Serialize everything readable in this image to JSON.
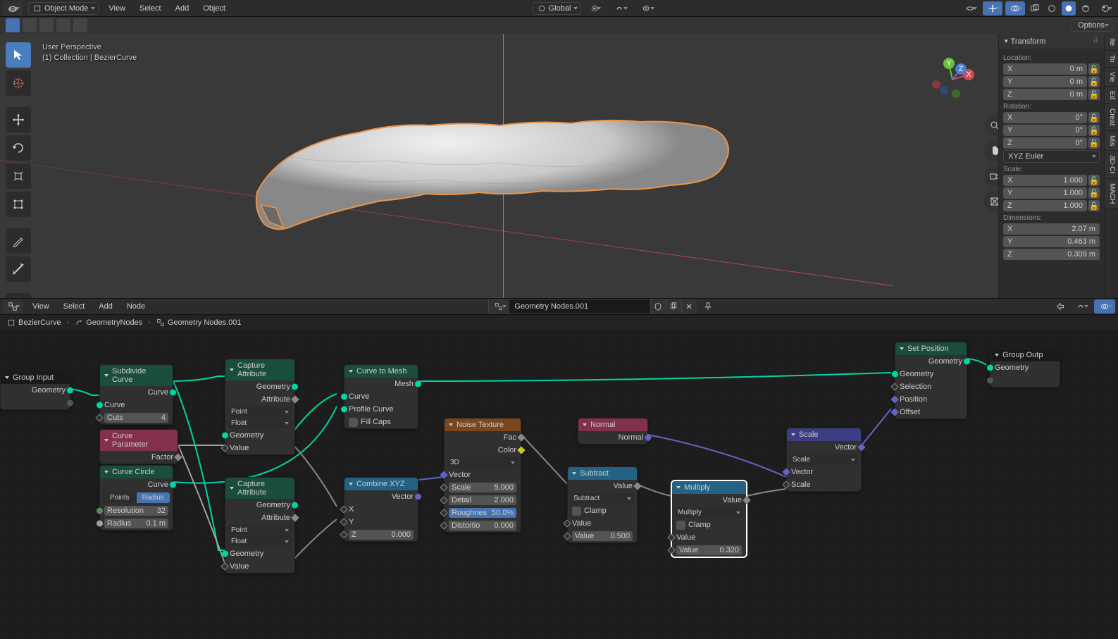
{
  "top": {
    "mode": "Object Mode",
    "menus": [
      "View",
      "Select",
      "Add",
      "Object"
    ],
    "orientation": "Global"
  },
  "shelf": {
    "options": "Options"
  },
  "viewport": {
    "perspective": "User Perspective",
    "breadcrumb": "(1) Collection | BezierCurve"
  },
  "npanel": {
    "header": "Transform",
    "loc_label": "Location:",
    "loc": [
      {
        "a": "X",
        "v": "0 m"
      },
      {
        "a": "Y",
        "v": "0 m"
      },
      {
        "a": "Z",
        "v": "0 m"
      }
    ],
    "rot_label": "Rotation:",
    "rot": [
      {
        "a": "X",
        "v": "0°"
      },
      {
        "a": "Y",
        "v": "0°"
      },
      {
        "a": "Z",
        "v": "0°"
      }
    ],
    "rot_mode": "XYZ Euler",
    "scale_label": "Scale:",
    "scale": [
      {
        "a": "X",
        "v": "1.000"
      },
      {
        "a": "Y",
        "v": "1.000"
      },
      {
        "a": "Z",
        "v": "1.000"
      }
    ],
    "dim_label": "Dimensions:",
    "dim": [
      {
        "a": "X",
        "v": "2.07 m"
      },
      {
        "a": "Y",
        "v": "0.463 m"
      },
      {
        "a": "Z",
        "v": "0.309 m"
      }
    ],
    "tabs": [
      "Ite",
      "To",
      "Vie",
      "Ed",
      "Creat",
      "Mis",
      "3D-Cr",
      "MACH"
    ]
  },
  "node_hdr": {
    "menus": [
      "View",
      "Select",
      "Add",
      "Node"
    ],
    "ng_name": "Geometry Nodes.001"
  },
  "breadcrumb": {
    "items": [
      "BezierCurve",
      "GeometryNodes",
      "Geometry Nodes.001"
    ]
  },
  "nodes": {
    "group_input": {
      "title": "Group Input",
      "out": "Geometry"
    },
    "subdivide": {
      "title": "Subdivide Curve",
      "out": "Curve",
      "in_curve": "Curve",
      "cuts_l": "Cuts",
      "cuts_v": "4"
    },
    "param": {
      "title": "Curve Parameter",
      "out": "Factor"
    },
    "circle": {
      "title": "Curve Circle",
      "out": "Curve",
      "radio": [
        "Points",
        "Radius"
      ],
      "res_l": "Resolution",
      "res_v": "32",
      "rad_l": "Radius",
      "rad_v": "0.1 m"
    },
    "cap1": {
      "title": "Capture Attribute",
      "o_g": "Geometry",
      "o_a": "Attribute",
      "d1": "Point",
      "d2": "Float",
      "i_g": "Geometry",
      "i_v": "Value"
    },
    "cap2": {
      "title": "Capture Attribute",
      "o_g": "Geometry",
      "o_a": "Attribute",
      "d1": "Point",
      "d2": "Float",
      "i_g": "Geometry",
      "i_v": "Value"
    },
    "c2m": {
      "title": "Curve to Mesh",
      "out": "Mesh",
      "i_c": "Curve",
      "i_p": "Profile Curve",
      "fill": "Fill Caps"
    },
    "cxyz": {
      "title": "Combine XYZ",
      "out": "Vector",
      "x": "X",
      "y": "Y",
      "z_l": "Z",
      "z_v": "0.000"
    },
    "noise": {
      "title": "Noise Texture",
      "o_f": "Fac",
      "o_c": "Color",
      "dim": "3D",
      "i_v": "Vector",
      "s_l": "Scale",
      "s_v": "5.000",
      "d_l": "Detail",
      "d_v": "2.000",
      "r_l": "Roughnes",
      "r_v": "50.0%",
      "di_l": "Distortio",
      "di_v": "0.000"
    },
    "sub": {
      "title": "Subtract",
      "out": "Value",
      "op": "Subtract",
      "clamp": "Clamp",
      "i_v": "Value",
      "v_l": "Value",
      "v_v": "0.500"
    },
    "normal": {
      "title": "Normal",
      "out": "Normal"
    },
    "mult": {
      "title": "Multiply",
      "out": "Value",
      "op": "Multiply",
      "clamp": "Clamp",
      "i_v": "Value",
      "v_l": "Value",
      "v_v": "0.320"
    },
    "vscale": {
      "title": "Scale",
      "out": "Vector",
      "op": "Scale",
      "i_v": "Vector",
      "i_s": "Scale"
    },
    "setpos": {
      "title": "Set Position",
      "o_g": "Geometry",
      "i_g": "Geometry",
      "i_sel": "Selection",
      "i_pos": "Position",
      "i_off": "Offset"
    },
    "gout": {
      "title": "Group Outp",
      "in": "Geometry"
    }
  }
}
